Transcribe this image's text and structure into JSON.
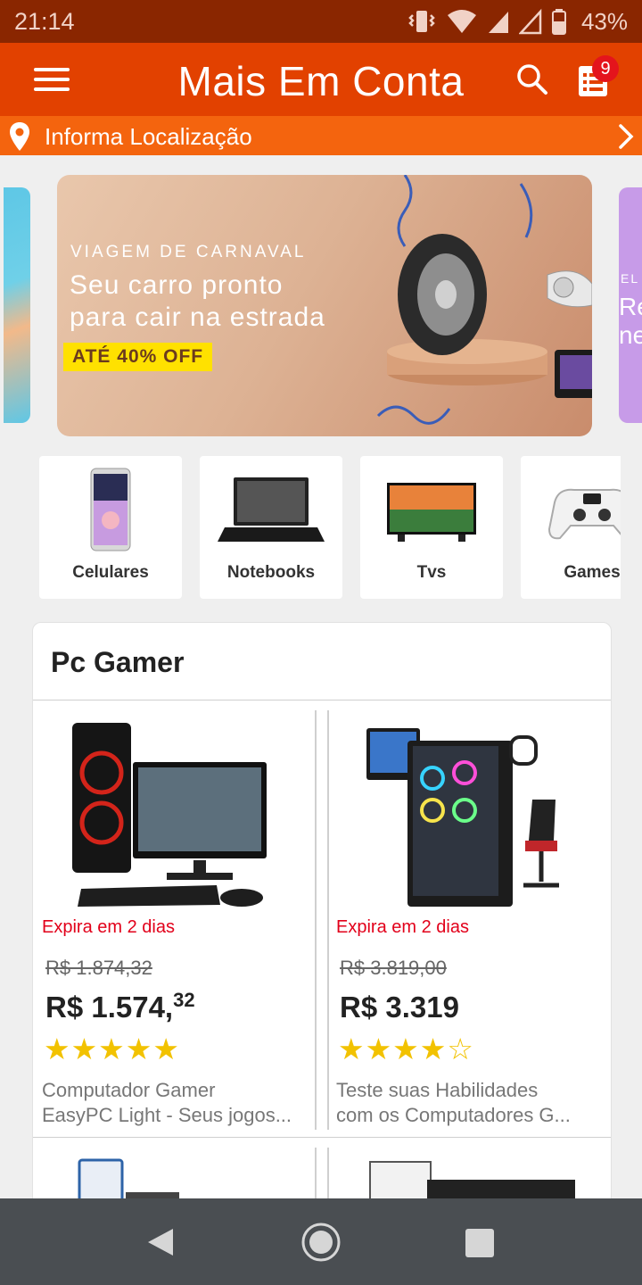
{
  "status_bar": {
    "time": "21:14",
    "battery": "43%",
    "icons": [
      "vibrate-icon",
      "wifi-icon",
      "signal-icon",
      "signal-empty-icon",
      "battery-icon"
    ]
  },
  "app_bar": {
    "title": "Mais Em Conta",
    "cart_count": "9",
    "color": "#e24100"
  },
  "location_bar": {
    "label": "Informa Localização",
    "color": "#f4640e"
  },
  "banner": {
    "kicker": "VIAGEM DE CARNAVAL",
    "headline_1": "Seu carro pronto",
    "headline_2": "para cair na estrada",
    "offer": "ATÉ 40% OFF",
    "next_peek_kicker": "EL",
    "next_peek_line_1": "Re",
    "next_peek_line_2": "ne"
  },
  "categories": [
    {
      "label": "Celulares",
      "icon": "smartphone-icon"
    },
    {
      "label": "Notebooks",
      "icon": "laptop-icon"
    },
    {
      "label": "Tvs",
      "icon": "tv-icon"
    },
    {
      "label": "Games",
      "icon": "gamepad-icon"
    }
  ],
  "section": {
    "title": "Pc Gamer",
    "products": [
      {
        "expires": "Expira em 2 dias",
        "old_price": "R$ 1.874,32",
        "price_main": "R$ 1.574,",
        "price_cents": "32",
        "rating": 5,
        "stars": "★★★★★",
        "desc_line_1": "Computador Gamer",
        "desc_line_2": "EasyPC Light - Seus jogos..."
      },
      {
        "expires": "Expira em 2 dias",
        "old_price": "R$ 3.819,00",
        "price_main": "R$ 3.319",
        "price_cents": "",
        "rating": 4,
        "stars": "★★★★",
        "stars_empty": "☆",
        "desc_line_1": "Teste suas Habilidades",
        "desc_line_2": "com os Computadores G..."
      }
    ]
  },
  "colors": {
    "accent": "#e24100",
    "expire_red": "#e2001a",
    "star": "#f2c200"
  }
}
